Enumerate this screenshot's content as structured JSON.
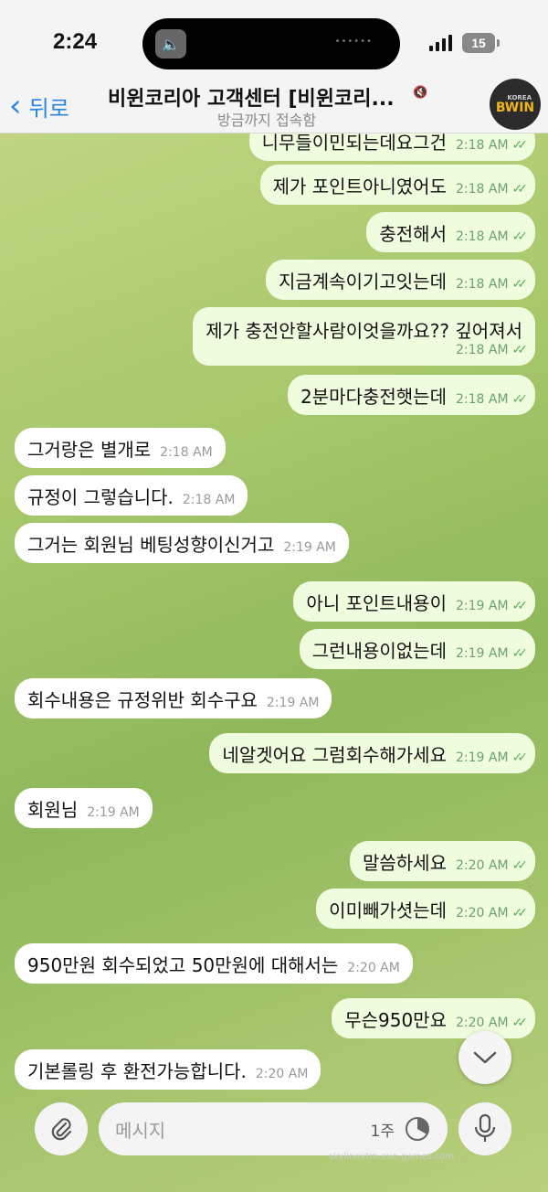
{
  "status": {
    "time": "2:24",
    "battery": "15"
  },
  "header": {
    "back_label": "뒤로",
    "title": "비윈코리아 고객센터 [비윈코리...",
    "subtitle": "방금까지 접속함",
    "avatar_text": "BWIN",
    "avatar_small": "KOREA"
  },
  "messages": [
    {
      "dir": "out",
      "text": "니무들이민되는데요그건",
      "time": "2:18 AM"
    },
    {
      "dir": "out",
      "text": "제가 포인트아니였어도",
      "time": "2:18 AM"
    },
    {
      "dir": "out",
      "text": "충전해서",
      "time": "2:18 AM"
    },
    {
      "dir": "out",
      "text": "지금계속이기고잇는데",
      "time": "2:18 AM"
    },
    {
      "dir": "out",
      "text": "제가 충전안할사람이엇을까요?? 깊어져서",
      "time": "2:18 AM"
    },
    {
      "dir": "out",
      "text": "2분마다충전햇는데",
      "time": "2:18 AM"
    },
    {
      "dir": "in",
      "text": "그거랑은 별개로",
      "time": "2:18 AM"
    },
    {
      "dir": "in",
      "text": "규정이 그렇습니다.",
      "time": "2:18 AM"
    },
    {
      "dir": "in",
      "text": "그거는 회원님 베팅성향이신거고",
      "time": "2:19 AM"
    },
    {
      "dir": "out",
      "text": "아니 포인트내용이",
      "time": "2:19 AM"
    },
    {
      "dir": "out",
      "text": "그런내용이없는데",
      "time": "2:19 AM"
    },
    {
      "dir": "in",
      "text": "회수내용은 규정위반 회수구요",
      "time": "2:19 AM"
    },
    {
      "dir": "out",
      "text": "네알겟어요 그럼회수해가세요",
      "time": "2:19 AM"
    },
    {
      "dir": "in",
      "text": "회원님",
      "time": "2:19 AM"
    },
    {
      "dir": "out",
      "text": "말씀하세요",
      "time": "2:20 AM"
    },
    {
      "dir": "out",
      "text": "이미빼가셧는데",
      "time": "2:20 AM"
    },
    {
      "dir": "in",
      "text": "950만원 회수되었고 50만원에 대해서는",
      "time": "2:20 AM"
    },
    {
      "dir": "out",
      "text": "무슨950만요",
      "time": "2:20 AM"
    },
    {
      "dir": "in",
      "text": "기본롤링 후 환전가능합니다.",
      "time": "2:20 AM"
    }
  ],
  "input": {
    "placeholder": "메시지",
    "timer_label": "1주",
    "preview_url": "skylinextm.evo-games.com"
  },
  "icons": {
    "back": "chevron-left-icon",
    "attach": "paperclip-icon",
    "mic": "microphone-icon",
    "scroll": "chevron-down-icon",
    "timer": "timer-icon"
  },
  "colors": {
    "outgoing_bubble": "#effdde",
    "incoming_bubble": "#ffffff",
    "accent": "#2a85e5",
    "ticks": "#5fae5f"
  }
}
